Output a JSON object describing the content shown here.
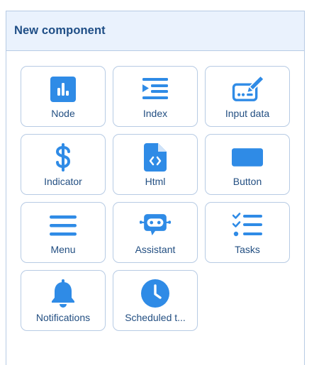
{
  "panel": {
    "title": "New component"
  },
  "colors": {
    "accent": "#2f8be6",
    "label": "#234f82",
    "header_bg": "#eaf2fd",
    "border": "#b7cbe4"
  },
  "components": [
    {
      "label": "Node",
      "icon": "bar-chart-icon"
    },
    {
      "label": "Index",
      "icon": "index-list-icon"
    },
    {
      "label": "Input data",
      "icon": "input-data-icon"
    },
    {
      "label": "Indicator",
      "icon": "dollar-icon"
    },
    {
      "label": "Html",
      "icon": "code-file-icon"
    },
    {
      "label": "Button",
      "icon": "button-icon"
    },
    {
      "label": "Menu",
      "icon": "hamburger-menu-icon"
    },
    {
      "label": "Assistant",
      "icon": "robot-icon"
    },
    {
      "label": "Tasks",
      "icon": "task-list-icon"
    },
    {
      "label": "Notifications",
      "icon": "bell-icon"
    },
    {
      "label": "Scheduled t...",
      "icon": "clock-icon"
    }
  ]
}
